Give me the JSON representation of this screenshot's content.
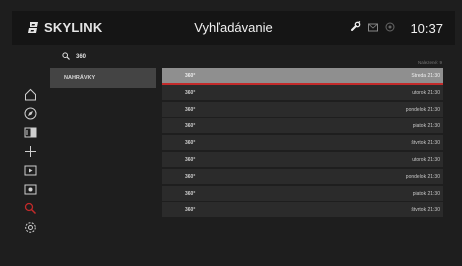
{
  "header": {
    "brand": "SKYLINK",
    "title": "Vyhľadávanie",
    "clock": "10:37"
  },
  "search": {
    "query": "360"
  },
  "categories": [
    {
      "label": "NAHRÁVKY"
    }
  ],
  "results": {
    "count_label": "Nalezené: 9",
    "items": [
      {
        "name": "360°",
        "date": "Streda 21:30",
        "selected": true
      },
      {
        "name": "360°",
        "date": "utorok 21:30"
      },
      {
        "name": "360°",
        "date": "pondelok 21:30"
      },
      {
        "name": "360°",
        "date": "piatok 21:30"
      },
      {
        "name": "360°",
        "date": "štvrtok 21:30"
      },
      {
        "name": "360°",
        "date": "utorok 21:30"
      },
      {
        "name": "360°",
        "date": "pondelok 21:30"
      },
      {
        "name": "360°",
        "date": "piatok 21:30"
      },
      {
        "name": "360°",
        "date": "štvrtok 21:30"
      }
    ]
  },
  "sidebar": {
    "items": [
      {
        "icon": "home-icon"
      },
      {
        "icon": "compass-icon"
      },
      {
        "icon": "tv-guide-icon"
      },
      {
        "icon": "plus-icon"
      },
      {
        "icon": "play-icon"
      },
      {
        "icon": "record-icon"
      },
      {
        "icon": "search-icon",
        "active": true
      },
      {
        "icon": "settings-icon"
      }
    ]
  },
  "colors": {
    "accent": "#c32a2a",
    "background": "#1e1e1e",
    "row": "#2b2b2b",
    "selected_row": "#8f8f8f"
  }
}
